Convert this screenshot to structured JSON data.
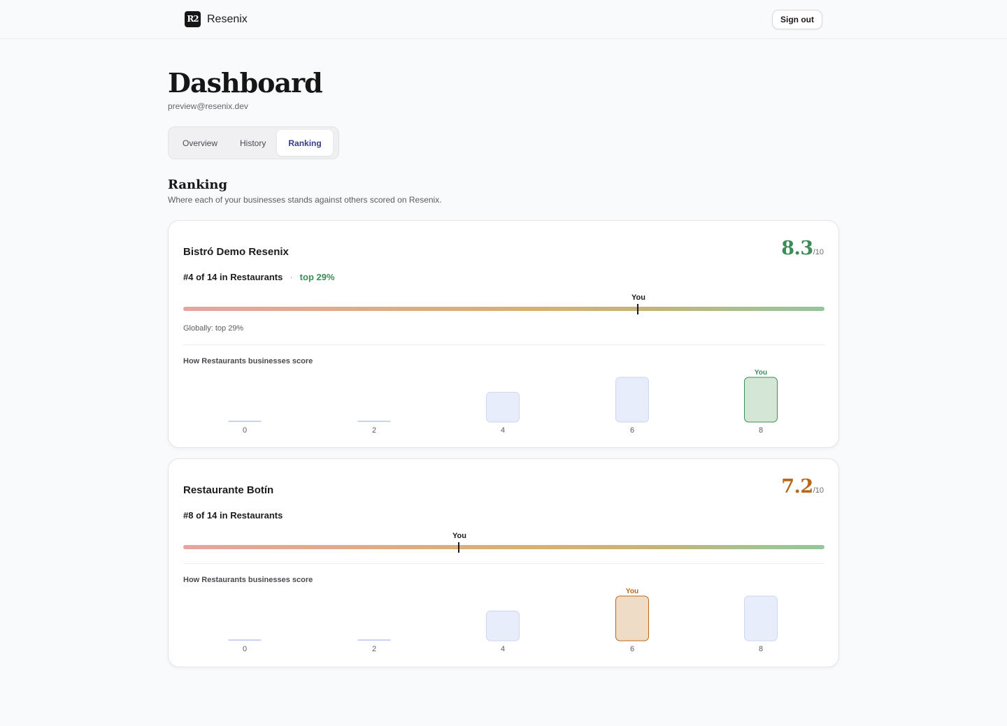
{
  "header": {
    "logo_text": "R2",
    "brand": "Resenix",
    "sign_out": "Sign out"
  },
  "page": {
    "title": "Dashboard",
    "email": "preview@resenix.dev"
  },
  "tabs": [
    {
      "label": "Overview",
      "active": false
    },
    {
      "label": "History",
      "active": false
    },
    {
      "label": "Ranking",
      "active": true
    }
  ],
  "section": {
    "title": "Ranking",
    "subtitle": "Where each of your businesses stands against others scored on Resenix."
  },
  "businesses": [
    {
      "name": "Bistró Demo Resenix",
      "score": "8.3",
      "score_max": "/10",
      "score_color": "#3d8c58",
      "rank": "#4 of 14 in Restaurants",
      "separator": "·",
      "top_pct": "top 29%",
      "marker_label": "You",
      "marker_position": 0.71,
      "global_text": "Globally: top 29%",
      "chart_title": "How Restaurants businesses score"
    },
    {
      "name": "Restaurante Botín",
      "score": "7.2",
      "score_max": "/10",
      "score_color": "#b8681a",
      "rank": "#8 of 14 in Restaurants",
      "marker_label": "You",
      "marker_position": 0.43,
      "chart_title": "How Restaurants businesses score"
    }
  ],
  "chart_data": [
    {
      "type": "bar",
      "categories": [
        "0",
        "2",
        "4",
        "6",
        "8"
      ],
      "values": [
        0,
        0,
        4,
        6,
        6
      ],
      "highlight_category": "8",
      "highlight_label": "You",
      "highlight_color": "#3d8c58",
      "highlight_fill": "#d4e6d5",
      "bar_fill": "#e8edfc",
      "bar_stroke": "#cdd6f3"
    },
    {
      "type": "bar",
      "categories": [
        "0",
        "2",
        "4",
        "6",
        "8"
      ],
      "values": [
        0,
        0,
        4,
        6,
        6
      ],
      "highlight_category": "6",
      "highlight_label": "You",
      "highlight_color": "#b8681a",
      "highlight_fill": "#efdcc7",
      "bar_fill": "#e8edfc",
      "bar_stroke": "#cdd6f3"
    }
  ]
}
